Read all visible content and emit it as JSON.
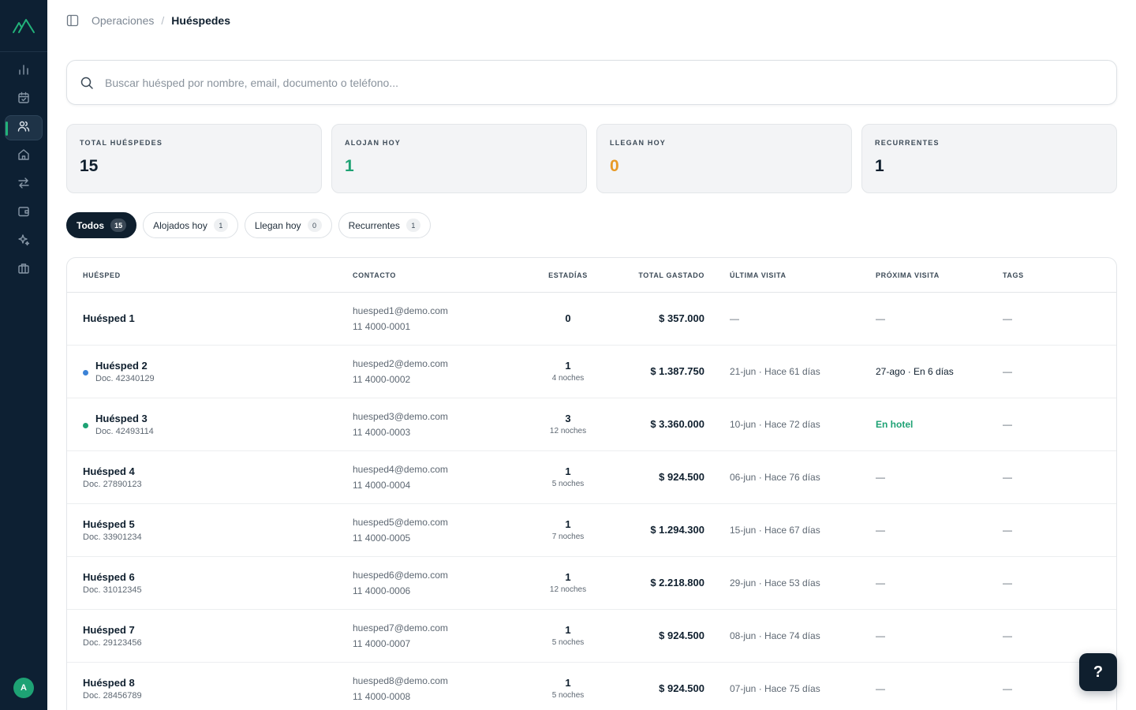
{
  "sidebar": {
    "icons": [
      "logo-icon",
      "bar-chart-icon",
      "calendar-check-icon",
      "users-icon",
      "home-icon",
      "arrows-swap-icon",
      "wallet-icon",
      "sparkles-icon",
      "briefcase-icon"
    ],
    "active_item": "users",
    "avatar_initial": "A"
  },
  "breadcrumb": {
    "parent": "Operaciones",
    "separator": "/",
    "current": "Huéspedes"
  },
  "search": {
    "placeholder": "Buscar huésped por nombre, email, documento o teléfono...",
    "value": ""
  },
  "stats": [
    {
      "label": "TOTAL HUÉSPEDES",
      "value": "15",
      "color": "#0f1f2e"
    },
    {
      "label": "ALOJAN HOY",
      "value": "1",
      "color": "#1ea274"
    },
    {
      "label": "LLEGAN HOY",
      "value": "0",
      "color": "#e89a26"
    },
    {
      "label": "RECURRENTES",
      "value": "1",
      "color": "#0f1f2e"
    }
  ],
  "filters": [
    {
      "label": "Todos",
      "count": "15",
      "active": true
    },
    {
      "label": "Alojados hoy",
      "count": "1",
      "active": false
    },
    {
      "label": "Llegan hoy",
      "count": "0",
      "active": false
    },
    {
      "label": "Recurrentes",
      "count": "1",
      "active": false
    }
  ],
  "table": {
    "columns": [
      "HUÉSPED",
      "CONTACTO",
      "ESTADÍAS",
      "TOTAL GASTADO",
      "ÚLTIMA VISITA",
      "PRÓXIMA VISITA",
      "TAGS"
    ],
    "rows": [
      {
        "name": "Huésped 1",
        "doc": "",
        "dot": "",
        "email": "huesped1@demo.com",
        "phone": "11 4000-0001",
        "stays": "0",
        "nights": "",
        "spent": "$ 357.000",
        "last": "—",
        "next": "—",
        "next_style": "muted",
        "tags": "—"
      },
      {
        "name": "Huésped 2",
        "doc": "Doc. 42340129",
        "dot": "#3b82d6",
        "email": "huesped2@demo.com",
        "phone": "11 4000-0002",
        "stays": "1",
        "nights": "4 noches",
        "spent": "$ 1.387.750",
        "last": "21-jun · Hace 61 días",
        "next": "27-ago · En 6 días",
        "next_style": "strong",
        "tags": "—"
      },
      {
        "name": "Huésped 3",
        "doc": "Doc. 42493114",
        "dot": "#1ea274",
        "email": "huesped3@demo.com",
        "phone": "11 4000-0003",
        "stays": "3",
        "nights": "12 noches",
        "spent": "$ 3.360.000",
        "last": "10-jun · Hace 72 días",
        "next": "En hotel",
        "next_style": "green",
        "tags": "—"
      },
      {
        "name": "Huésped 4",
        "doc": "Doc. 27890123",
        "dot": "",
        "email": "huesped4@demo.com",
        "phone": "11 4000-0004",
        "stays": "1",
        "nights": "5 noches",
        "spent": "$ 924.500",
        "last": "06-jun · Hace 76 días",
        "next": "—",
        "next_style": "muted",
        "tags": "—"
      },
      {
        "name": "Huésped 5",
        "doc": "Doc. 33901234",
        "dot": "",
        "email": "huesped5@demo.com",
        "phone": "11 4000-0005",
        "stays": "1",
        "nights": "7 noches",
        "spent": "$ 1.294.300",
        "last": "15-jun · Hace 67 días",
        "next": "—",
        "next_style": "muted",
        "tags": "—"
      },
      {
        "name": "Huésped 6",
        "doc": "Doc. 31012345",
        "dot": "",
        "email": "huesped6@demo.com",
        "phone": "11 4000-0006",
        "stays": "1",
        "nights": "12 noches",
        "spent": "$ 2.218.800",
        "last": "29-jun · Hace 53 días",
        "next": "—",
        "next_style": "muted",
        "tags": "—"
      },
      {
        "name": "Huésped 7",
        "doc": "Doc. 29123456",
        "dot": "",
        "email": "huesped7@demo.com",
        "phone": "11 4000-0007",
        "stays": "1",
        "nights": "5 noches",
        "spent": "$ 924.500",
        "last": "08-jun · Hace 74 días",
        "next": "—",
        "next_style": "muted",
        "tags": "—"
      },
      {
        "name": "Huésped 8",
        "doc": "Doc. 28456789",
        "dot": "",
        "email": "huesped8@demo.com",
        "phone": "11 4000-0008",
        "stays": "1",
        "nights": "5 noches",
        "spent": "$ 924.500",
        "last": "07-jun · Hace 75 días",
        "next": "—",
        "next_style": "muted",
        "tags": "—"
      }
    ]
  },
  "help_button": {
    "label": "?"
  }
}
